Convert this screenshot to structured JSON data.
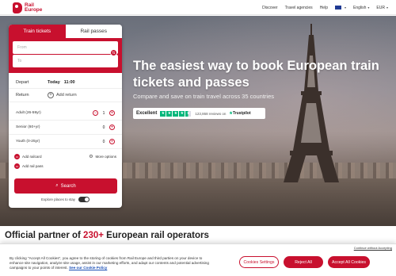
{
  "colors": {
    "brand": "#c8102e",
    "trustpilot": "#00b67a"
  },
  "header": {
    "logo": {
      "line1": "Rail",
      "line2": "Europe"
    },
    "nav": {
      "discover": "Discover",
      "travel_agencies": "Travel agencies",
      "help": "Help",
      "language": "English",
      "currency": "EUR"
    }
  },
  "hero": {
    "title": "The easiest way to book European train tickets and passes",
    "subtitle": "Compare and save on train travel across 35 countries",
    "trustpilot": {
      "rating_label": "Excellent",
      "stars": 4.5,
      "reviews": "123,868 reviews on",
      "brand": "Trustpilot"
    }
  },
  "booking": {
    "tabs": [
      "Train tickets",
      "Rail passes"
    ],
    "from_placeholder": "From",
    "to_placeholder": "To",
    "depart": {
      "label": "Depart",
      "day": "Today",
      "time": "11:00"
    },
    "return": {
      "label": "Return",
      "add": "Add return"
    },
    "passengers": [
      {
        "label": "Adult (26-59yr)",
        "count": "1"
      },
      {
        "label": "Senior (60+yr)",
        "count": "0"
      },
      {
        "label": "Youth (0-25yr)",
        "count": "0"
      }
    ],
    "add_railcard": "Add railcard",
    "more_options": "More options",
    "add_rail_pass": "Add rail pass",
    "search": "Search",
    "explore": "Explore places to stay"
  },
  "partner": {
    "prefix": "Official partner of ",
    "highlight": "230+",
    "suffix": " European rail operators"
  },
  "cookie": {
    "close_link": "Continue without Accepting",
    "text": "By clicking \"Accept All Cookies\", you agree to the storing of cookies from Rail Europe and third parties on your device to enhance site navigation, analyze site usage, assist in our marketing efforts, and adapt our contents and potential advertising campaigns to your points of interest.",
    "policy_link": "See our Cookie Policy",
    "settings": "Cookies Settings",
    "reject": "Reject All",
    "accept": "Accept All Cookies"
  }
}
